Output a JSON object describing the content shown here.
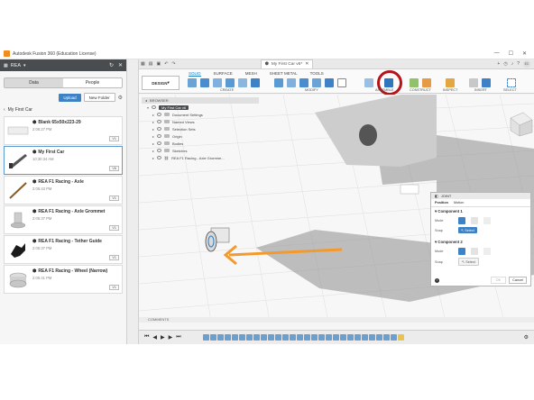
{
  "window": {
    "title": "Autodesk Fusion 360 (Education License)"
  },
  "data_panel": {
    "team_name": "REA",
    "tabs": [
      {
        "label": "Data",
        "active": true
      },
      {
        "label": "People",
        "active": false
      }
    ],
    "upload_label": "Upload",
    "new_folder_label": "New Folder",
    "breadcrumb": "My First Car",
    "files": [
      {
        "name": "Blank 65x50x223-29",
        "date": "2:06:27 PM",
        "version": "V1",
        "selected": false
      },
      {
        "name": "My First Car",
        "date": "10:30:34 AM",
        "version": "V6",
        "selected": true
      },
      {
        "name": "REA F1 Racing - Axle",
        "date": "2:05:43 PM",
        "version": "V1",
        "selected": false
      },
      {
        "name": "REA F1 Racing - Axle Grommet",
        "date": "2:05:37 PM",
        "version": "V1",
        "selected": false
      },
      {
        "name": "REA F1 Racing - Tether Guide",
        "date": "2:05:37 PM",
        "version": "V1",
        "selected": false
      },
      {
        "name": "REA F1 Racing - Wheel (Narrow)",
        "date": "2:05:41 PM",
        "version": "V1",
        "selected": false
      }
    ]
  },
  "document": {
    "tab_title": "My First Car v6*",
    "user_initials": "EC"
  },
  "ribbon": {
    "workspace_label": "DESIGN",
    "tabs": [
      {
        "label": "SOLID",
        "active": true
      },
      {
        "label": "SURFACE",
        "active": false
      },
      {
        "label": "MESH",
        "active": false
      },
      {
        "label": "SHEET METAL",
        "active": false
      },
      {
        "label": "TOOLS",
        "active": false
      }
    ],
    "groups": [
      "CREATE",
      "MODIFY",
      "ASSEMBLE",
      "CONSTRUCT",
      "INSPECT",
      "INSERT",
      "SELECT"
    ]
  },
  "browser": {
    "header": "BROWSER",
    "root": "My First Car v6",
    "items": [
      "Document Settings",
      "Named Views",
      "Selection Sets",
      "Origin",
      "Bodies",
      "Sketches",
      "REA F1 Racing - Axle Gromme..."
    ]
  },
  "joint_dialog": {
    "title": "JOINT",
    "tabs": [
      "Position",
      "Motion"
    ],
    "component1": {
      "title": "Component 1",
      "mode_label": "Mode",
      "snap_label": "Snap",
      "select_label": "Select"
    },
    "component2": {
      "title": "Component 2",
      "mode_label": "Mode",
      "snap_label": "Snap",
      "select_label": "Select"
    },
    "ok_label": "OK",
    "cancel_label": "Cancel"
  },
  "comments_label": "COMMENTS",
  "colors": {
    "accent": "#3d82c4",
    "highlight_ring": "#b5141b",
    "arrow": "#f39a2e"
  }
}
